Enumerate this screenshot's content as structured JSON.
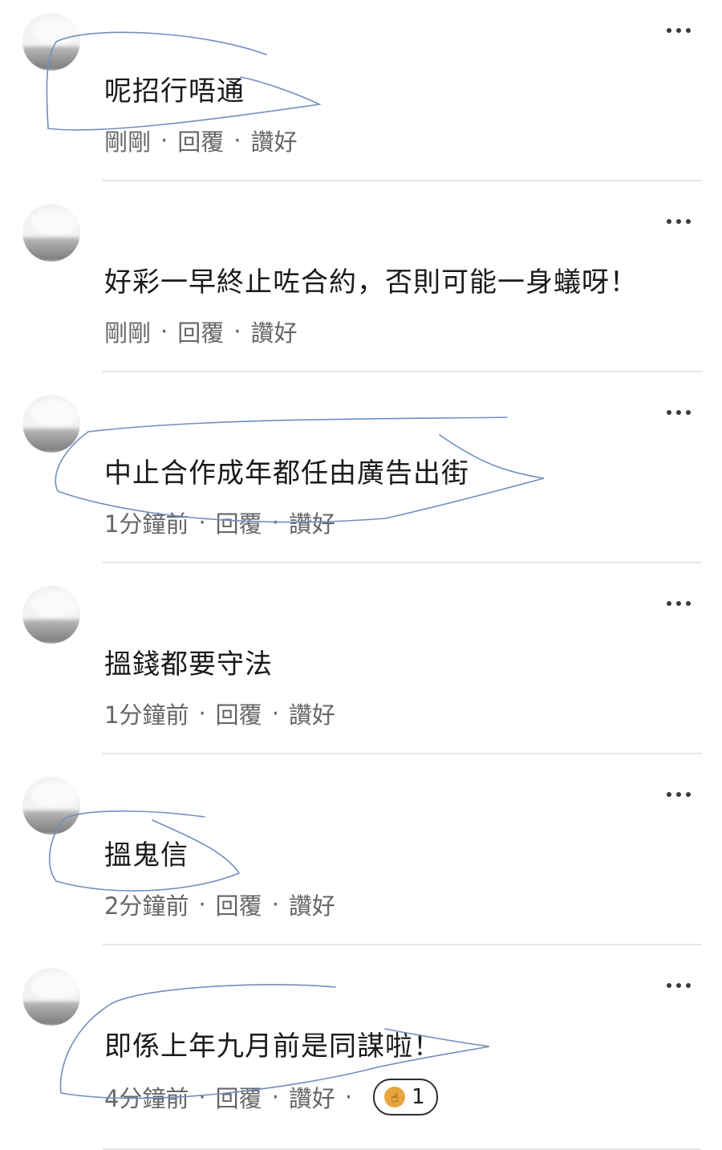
{
  "comments": [
    {
      "text": "呢招行唔通",
      "time": "剛剛",
      "reply": "回覆",
      "like": "讚好"
    },
    {
      "text": "好彩一早終止咗合約，否則可能一身蟻呀！",
      "time": "剛剛",
      "reply": "回覆",
      "like": "讚好"
    },
    {
      "text": "中止合作成年都任由廣告出街",
      "time": "1分鐘前",
      "reply": "回覆",
      "like": "讚好"
    },
    {
      "text": "搵錢都要守法",
      "time": "1分鐘前",
      "reply": "回覆",
      "like": "讚好"
    },
    {
      "text": "搵鬼信",
      "time": "2分鐘前",
      "reply": "回覆",
      "like": "讚好"
    },
    {
      "text": "即係上年九月前是同謀啦！",
      "time": "4分鐘前",
      "reply": "回覆",
      "like": "讚好",
      "reaction_count": "1"
    }
  ],
  "separator": "·",
  "icons": {
    "more": "more-horizontal-icon",
    "reaction": "thumbs-up-icon"
  },
  "colors": {
    "text": "#1a1a1a",
    "meta": "#666666",
    "divider": "#e4e4e4",
    "scribble": "#6f8fbf",
    "reaction": "#e7a53b"
  }
}
